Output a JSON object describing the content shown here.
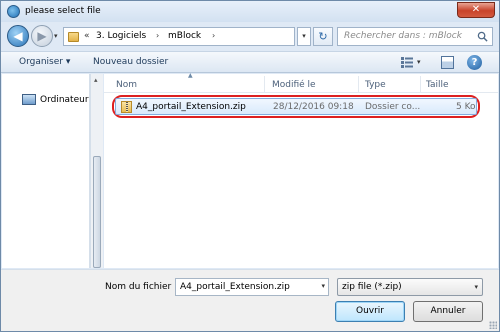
{
  "window": {
    "title": "please select file",
    "close_label": "✕"
  },
  "nav": {
    "back_glyph": "◀",
    "forward_glyph": "▶",
    "history_glyph": "▾",
    "address": {
      "overflow": "«",
      "segments": [
        "3. Logiciels",
        "mBlock"
      ],
      "separator": "›"
    },
    "address_dropdown_glyph": "▾",
    "refresh_glyph": "↻",
    "search_placeholder": "Rechercher dans : mBlock"
  },
  "commandbar": {
    "organiser": "Organiser ▾",
    "new_folder": "Nouveau dossier",
    "view_drop": "▾",
    "help": "?"
  },
  "navpane": {
    "items": [
      {
        "label": "Ordinateur",
        "icon": "computer-icon"
      }
    ],
    "scroll_up": "▴"
  },
  "filelist": {
    "sort_arrow": "▲",
    "columns": [
      "Nom",
      "Modifié le",
      "Type",
      "Taille"
    ],
    "rows": [
      {
        "name": "A4_portail_Extension.zip",
        "modified": "28/12/2016 09:18",
        "type": "Dossier co...",
        "size": "5 Ko",
        "icon": "zip-folder-icon",
        "highlighted": true
      }
    ]
  },
  "bottom": {
    "filename_label": "Nom du fichier :",
    "filename_value": "A4_portail_Extension.zip",
    "filename_drop": "▾",
    "filter_value": "zip file (*.zip)",
    "filter_drop": "▾",
    "open_label": "Ouvrir",
    "cancel_label": "Annuler"
  },
  "colors": {
    "highlight_ring": "#dd2020",
    "selection": "#d9eafc",
    "chrome": "#dfe9f5"
  }
}
